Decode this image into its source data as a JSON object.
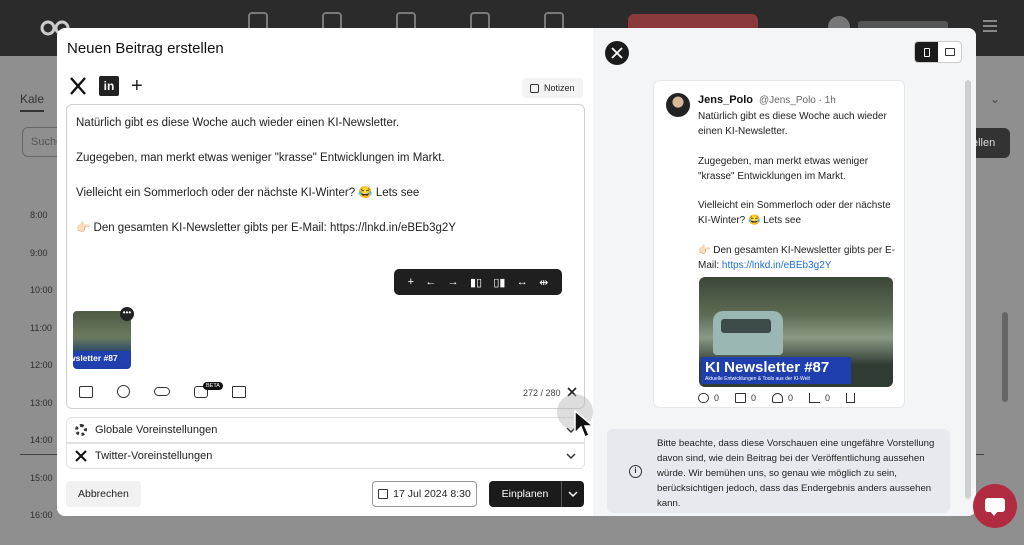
{
  "background": {
    "tab_label": "Kale",
    "search_placeholder": "Suche",
    "right_button": "ellen",
    "times": [
      "8:00",
      "9:00",
      "10:00",
      "11:00",
      "12:00",
      "13:00",
      "14:00",
      "15:00",
      "16:00"
    ]
  },
  "modal": {
    "title": "Neuen Beitrag erstellen",
    "platforms": [
      "x-logo-icon",
      "linkedin-icon",
      "plus-icon"
    ],
    "notes_label": "Notizen",
    "post_text": [
      "Natürlich gibt es diese Woche auch wieder einen KI-Newsletter.",
      "Zugegeben, man merkt etwas weniger \"krasse\" Entwicklungen im Markt.",
      "Vielleicht ein Sommerloch oder der nächste KI-Winter? 😂 Lets see",
      "👉🏻 Den gesamten KI-Newsletter gibts per E-Mail: https://lnkd.in/eBEb3g2Y"
    ],
    "image_toolbar": [
      "+",
      "←",
      "→",
      "▮▯",
      "▯▮",
      "↔",
      "⇹"
    ],
    "thumbnail_label": "wsletter #87",
    "thumbnail_menu": "•••",
    "beta_badge": "BETA",
    "char_count": "272 / 280",
    "settings": {
      "global_label": "Globale Voreinstellungen",
      "twitter_label": "Twitter-Voreinstellungen"
    },
    "cancel_label": "Abbrechen",
    "date_label": "17 Jul 2024 8:30",
    "schedule_label": "Einplanen"
  },
  "preview": {
    "author_name": "Jens_Polo",
    "author_meta": "@Jens_Polo · 1h",
    "text_lines": [
      "Natürlich gibt es diese Woche auch wieder einen KI-Newsletter.",
      "Zugegeben, man merkt etwas weniger \"krasse\" Entwicklungen im Markt.",
      "Vielleicht ein Sommerloch oder der nächste KI-Winter? 😂 Lets see",
      "👉🏻 Den gesamten KI-Newsletter gibts per E-Mail:"
    ],
    "link": "https://lnkd.in/eBEb3g2Y",
    "image_title": "KI Newsletter #87",
    "image_subtitle": "Aktuelle Entwicklungen & Tools aus der KI-Welt",
    "counts": {
      "replies": "0",
      "retweets": "0",
      "likes": "0",
      "views": "0"
    },
    "info_text": "Bitte beachte, dass diese Vorschauen eine ungefähre Vorstellung davon sind, wie dein Beitrag bei der Veröffentlichung aussehen würde. Wir bemühen uns, so genau wie möglich zu sein, berücksichtigen jedoch, dass das Endergebnis anders aussehen kann.",
    "info_icon": "i"
  },
  "colors": {
    "primary_dark": "#1b1b1b",
    "link_blue": "#1d6fd8",
    "banner_blue": "#1f3fae",
    "chat_red": "#b02b40"
  }
}
